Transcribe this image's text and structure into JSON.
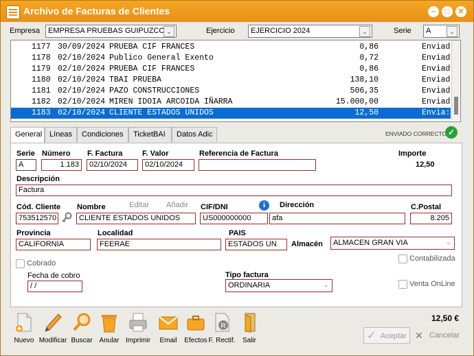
{
  "window": {
    "title": "Archivo de Facturas de Clientes"
  },
  "top": {
    "empresa_label": "Empresa",
    "empresa_value": "EMPRESA PRUEBAS GUIPUZCOA",
    "ejercicio_label": "Ejercicio",
    "ejercicio_value": "EJERCICIO 2024",
    "serie_label": "Serie",
    "serie_value": "A"
  },
  "invoice_list": [
    {
      "num": "1177",
      "date": "30/09/2024",
      "client": "PRUEBA CIF FRANCES",
      "amount": "0,86",
      "status": "Enviad"
    },
    {
      "num": "1178",
      "date": "02/10/2024",
      "client": "Publico General Exento",
      "amount": "0,72",
      "status": "Enviad"
    },
    {
      "num": "1179",
      "date": "02/10/2024",
      "client": "PRUEBA CIF FRANCES",
      "amount": "0,86",
      "status": "Enviad"
    },
    {
      "num": "1180",
      "date": "02/10/2024",
      "client": "TBAI PRUEBA",
      "amount": "138,10",
      "status": "Enviad"
    },
    {
      "num": "1181",
      "date": "02/10/2024",
      "client": "PAZO CONSTRUCCIONES",
      "amount": "506,35",
      "status": "Enviad"
    },
    {
      "num": "1182",
      "date": "02/10/2024",
      "client": "MIREN IDOIA ARCOIDA IÑARRA",
      "amount": "15.000,00",
      "status": "Enviad"
    },
    {
      "num": "1183",
      "date": "02/10/2024",
      "client": "CLIENTE ESTADOS UNIDOS",
      "amount": "12,50",
      "status": "Envia:"
    }
  ],
  "tabs": [
    "General",
    "Líneas",
    "Condiciones",
    "TicketBAI",
    "Datos Adic"
  ],
  "status_text": "ENVIADO CORRECTO",
  "form": {
    "serie_label": "Serie",
    "serie": "A",
    "numero_label": "Número",
    "numero": "1.183",
    "ffactura_label": "F. Factura",
    "ffactura": "02/10/2024",
    "fvalor_label": "F. Valor",
    "fvalor": "02/10/2024",
    "referencia_label": "Referencia de Factura",
    "referencia": "",
    "importe_label": "Importe",
    "importe": "12,50",
    "descripcion_label": "Descripción",
    "descripcion": "Factura",
    "codcliente_label": "Cód. Cliente",
    "codcliente": "753512570",
    "nombre_label": "Nombre",
    "nombre": "CLIENTE ESTADOS UNIDOS",
    "editar_label": "Editar",
    "anadir_label": "Añadir",
    "cif_label": "CIF/DNI",
    "cif": "US000000000",
    "direccion_label": "Dirección",
    "direccion": "afa",
    "cpostal_label": "C.Postal",
    "cpostal": "8.205",
    "provincia_label": "Provincia",
    "provincia": "CALIFORNIA",
    "localidad_label": "Localidad",
    "localidad": "FEERAE",
    "pais_label": "PAIS",
    "pais": "ESTADOS UN",
    "almacen_label": "Almacén",
    "almacen": "ALMACEN GRAN VIA",
    "cobrado_label": "Cobrado",
    "contabilizada_label": "Contabilizada",
    "fechacobro_label": "Fecha de cobro",
    "fechacobro": " / /",
    "tipofactura_label": "Tipo factura",
    "tipofactura": "ORDINARIA",
    "ventaonline_label": "Venta OnLine"
  },
  "toolbar": {
    "nuevo": "Nuevo",
    "modificar": "Modificar",
    "buscar": "Buscar",
    "anular": "Anular",
    "imprimir": "Imprimir",
    "email": "Email",
    "efectos": "Efectos",
    "frectif": "F. Rectif.",
    "salir": "Salir"
  },
  "total": "12,50 €",
  "aceptar": "Aceptar",
  "cancelar": "Cancelar"
}
